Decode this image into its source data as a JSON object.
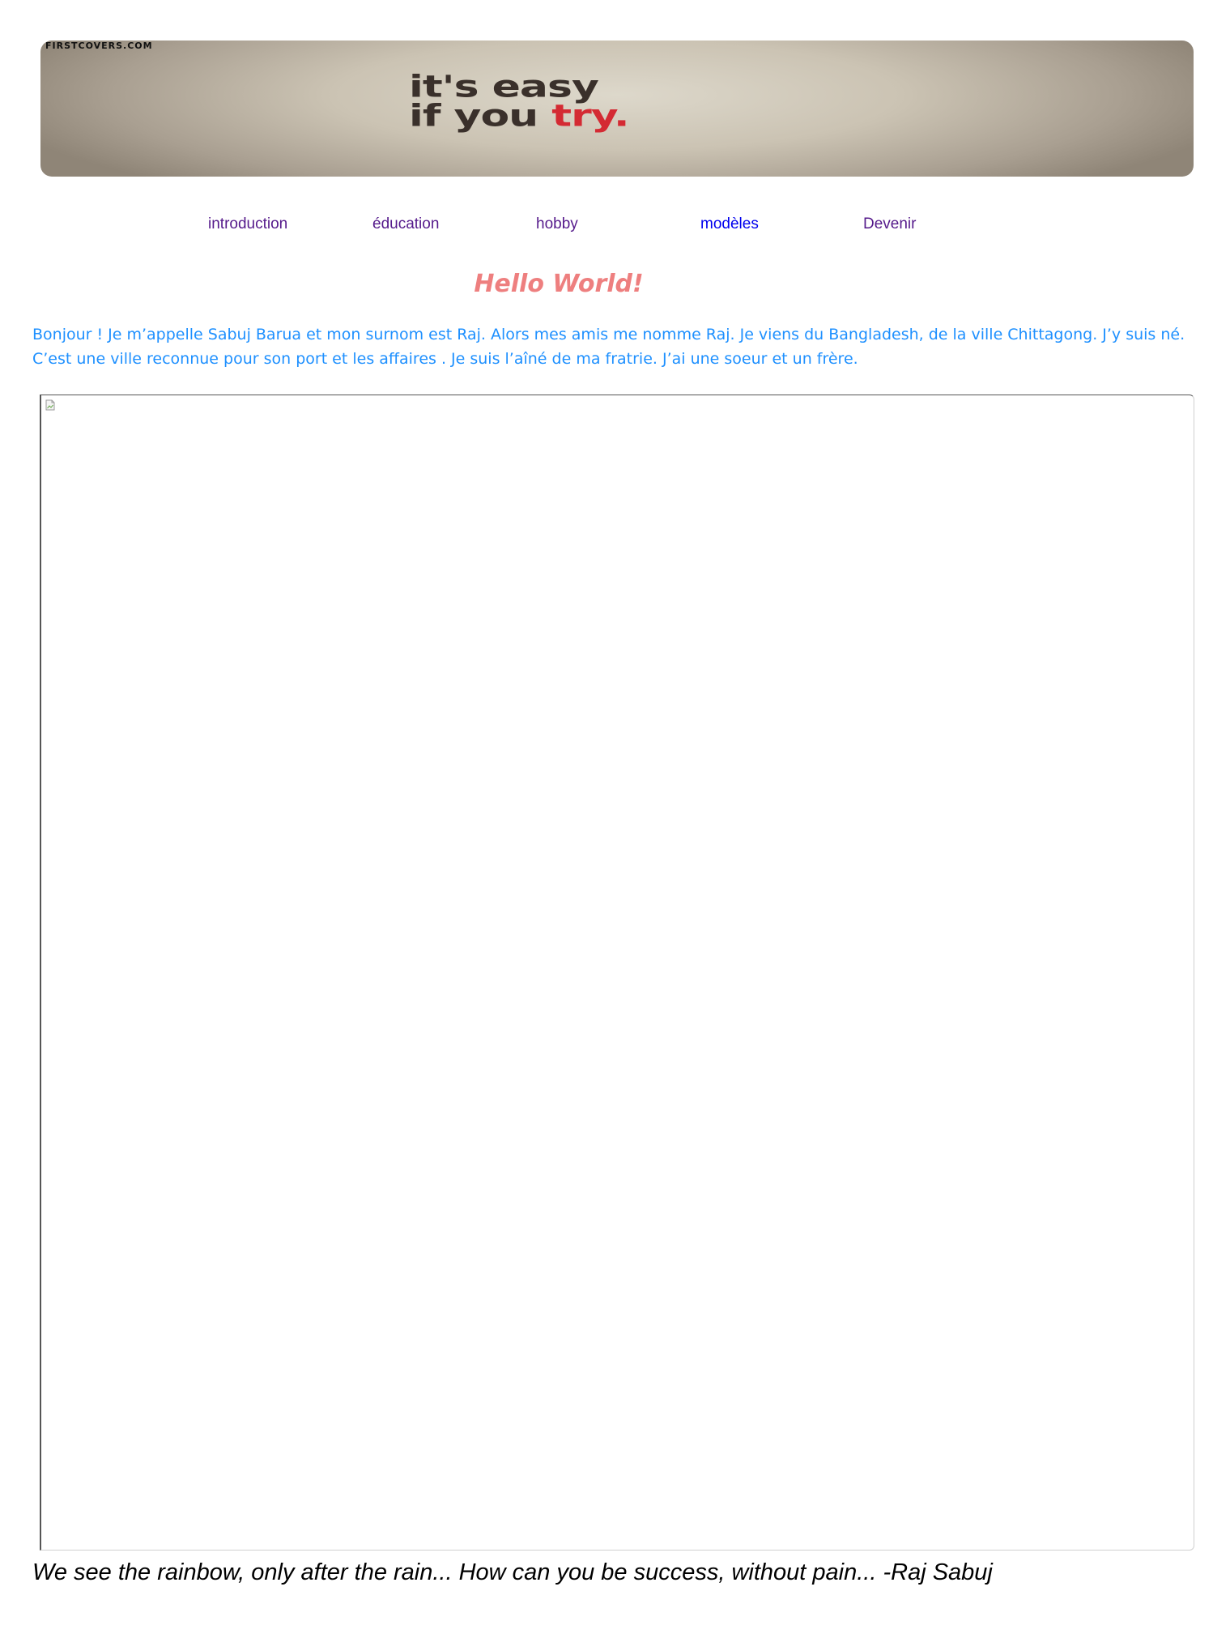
{
  "banner": {
    "credit": "FIRSTCOVERS.COM",
    "line1": "it's easy",
    "line2_prefix": "if you ",
    "line2_accent": "try."
  },
  "nav": {
    "items": [
      {
        "label": "introduction",
        "state": "visited"
      },
      {
        "label": "éducation",
        "state": "visited"
      },
      {
        "label": "hobby",
        "state": "visited"
      },
      {
        "label": "modèles",
        "state": "unvisited"
      },
      {
        "label": "Devenir",
        "state": "visited"
      }
    ]
  },
  "main": {
    "heading": "Hello World!",
    "intro": "Bonjour ! Je m’appelle Sabuj Barua et mon surnom est Raj. Alors mes amis me nomme Raj. Je viens du Bangladesh, de la ville Chittagong. J’y suis né. C’est une ville reconnue pour son port et les affaires . Je suis l’aîné de ma fratrie. J’ai une soeur et un frère."
  },
  "embed": {
    "icon": "broken-image-icon"
  },
  "footer": {
    "quote": "We see the rainbow, only after the rain... How can you be success, without pain... -Raj Sabuj"
  },
  "colors": {
    "heading": "#ee7f7f",
    "intro": "#1e90ff",
    "link_visited": "#551a8b",
    "link_unvisited": "#0000ee",
    "banner_accent": "#d42a33"
  }
}
